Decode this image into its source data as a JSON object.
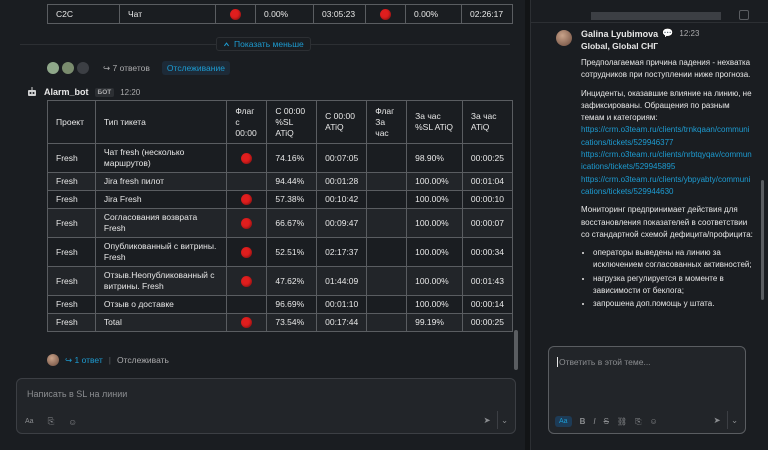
{
  "top_row": [
    "C2C",
    "Чат",
    "",
    "0.00%",
    "03:05:23",
    "",
    "0.00%",
    "02:26:17"
  ],
  "show_less": "Показать меньше",
  "thread1": {
    "replies": "7 ответов",
    "follow": "Отслеживание"
  },
  "bot": {
    "name": "Alarm_bot",
    "badge": "БОТ",
    "time": "12:20"
  },
  "table": {
    "headers": [
      "Проект",
      "Тип тикета",
      "Флаг с 00:00",
      "С 00:00 %SL ATiQ",
      "С 00:00 ATiQ",
      "Флаг За час",
      "За час %SL ATiQ",
      "За час ATiQ"
    ],
    "rows": [
      {
        "project": "Fresh",
        "type": "Чат fresh (несколько маршрутов)",
        "flag1": true,
        "sl1": "74.16%",
        "atiq1": "00:07:05",
        "flag2": false,
        "sl2": "98.90%",
        "atiq2": "00:00:25"
      },
      {
        "project": "Fresh",
        "type": "Jira fresh пилот",
        "flag1": false,
        "sl1": "94.44%",
        "atiq1": "00:01:28",
        "flag2": false,
        "sl2": "100.00%",
        "atiq2": "00:01:04"
      },
      {
        "project": "Fresh",
        "type": "Jira Fresh",
        "flag1": true,
        "sl1": "57.38%",
        "atiq1": "00:10:42",
        "flag2": false,
        "sl2": "100.00%",
        "atiq2": "00:00:10"
      },
      {
        "project": "Fresh",
        "type": "Согласования возврата Fresh",
        "flag1": true,
        "sl1": "66.67%",
        "atiq1": "00:09:47",
        "flag2": false,
        "sl2": "100.00%",
        "atiq2": "00:00:07"
      },
      {
        "project": "Fresh",
        "type": "Опубликованный с витрины. Fresh",
        "flag1": true,
        "sl1": "52.51%",
        "atiq1": "02:17:37",
        "flag2": false,
        "sl2": "100.00%",
        "atiq2": "00:00:34"
      },
      {
        "project": "Fresh",
        "type": "Отзыв.Неопубликованный с витрины. Fresh",
        "flag1": true,
        "sl1": "47.62%",
        "atiq1": "01:44:09",
        "flag2": false,
        "sl2": "100.00%",
        "atiq2": "00:01:43"
      },
      {
        "project": "Fresh",
        "type": "Отзыв о доставке",
        "flag1": false,
        "sl1": "96.69%",
        "atiq1": "00:01:10",
        "flag2": false,
        "sl2": "100.00%",
        "atiq2": "00:00:14"
      },
      {
        "project": "Fresh",
        "type": "Total",
        "flag1": true,
        "sl1": "73.54%",
        "atiq1": "00:17:44",
        "flag2": false,
        "sl2": "99.19%",
        "atiq2": "00:00:25"
      }
    ]
  },
  "thread2": {
    "replies": "1 ответ",
    "follow": "Отслеживать"
  },
  "composer": {
    "placeholder": "Написать в SL на линии"
  },
  "thread_panel": {
    "author": "Galina Lyubimova",
    "time": "12:23",
    "subtitle": "Global, Global СНГ",
    "p1": "Предполагаемая причина падения - нехватка сотрудников при поступлении ниже прогноза.",
    "p2": "Инциденты, оказавшие влияние на линию, не зафиксированы. Обращения по разным темам и категориям:",
    "links": [
      "https://crm.o3team.ru/clients/trnkqaan/communications/tickets/529946377",
      "https://crm.o3team.ru/clients/nrbtqyqav/communications/tickets/529945895",
      "https://crm.o3team.ru/clients/ybpyabty/communications/tickets/529944630"
    ],
    "p3": "Мониторинг предпринимает действия для восстановления показателей в соответствии со стандартной схемой дефицита/профицита:",
    "bullets": [
      "операторы выведены на линию за исключением согласованных активностей;",
      "нагрузка регулируется в моменте в зависимости от беклога;",
      "запрошена доп.помощь у штата."
    ],
    "reply_placeholder": "Ответить в этой теме..."
  }
}
